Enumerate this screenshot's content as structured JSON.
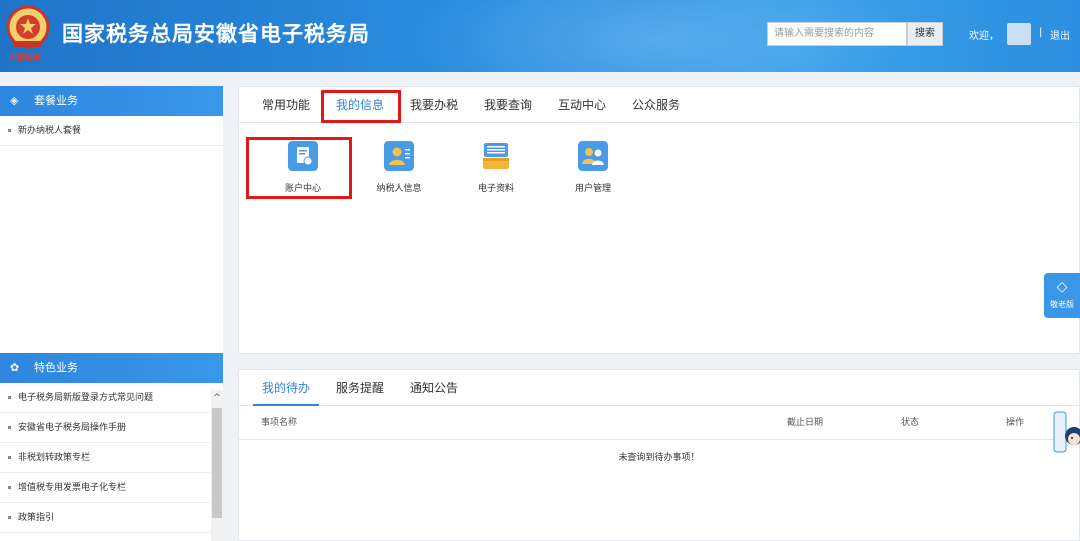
{
  "header": {
    "emblem_caption": "中国税务",
    "title": "国家税务总局安徽省电子税务局",
    "search_placeholder": "请输入需要搜索的内容",
    "search_button": "搜索",
    "welcome": "欢迎，",
    "separator": "|",
    "logout": "退出"
  },
  "sidebar": {
    "section1": {
      "title": "套餐业务",
      "items": [
        "新办纳税人套餐"
      ]
    },
    "section2": {
      "title": "特色业务",
      "items": [
        "电子税务局新版登录方式常见问题",
        "安徽省电子税务局操作手册",
        "非税划转政策专栏",
        "增值税专用发票电子化专栏",
        "政策指引"
      ]
    },
    "scroll_up": "^"
  },
  "main": {
    "tabs": [
      "常用功能",
      "我的信息",
      "我要办税",
      "我要查询",
      "互动中心",
      "公众服务"
    ],
    "active_tab": "我的信息",
    "tiles": [
      {
        "label": "账户中心",
        "icon": "account-center-icon"
      },
      {
        "label": "纳税人信息",
        "icon": "taxpayer-info-icon"
      },
      {
        "label": "电子资料",
        "icon": "electronic-documents-icon"
      },
      {
        "label": "用户管理",
        "icon": "user-management-icon"
      }
    ]
  },
  "float_button": {
    "label": "敬老版",
    "icon": "elderly-mode-icon"
  },
  "bottom": {
    "tabs": [
      "我的待办",
      "服务提醒",
      "通知公告"
    ],
    "active_tab": "我的待办",
    "columns": [
      "事项名称",
      "截止日期",
      "状态",
      "操作"
    ],
    "empty_message": "未查询到待办事项！"
  },
  "colors": {
    "primary": "#2e86de",
    "highlight": "#e01818"
  }
}
